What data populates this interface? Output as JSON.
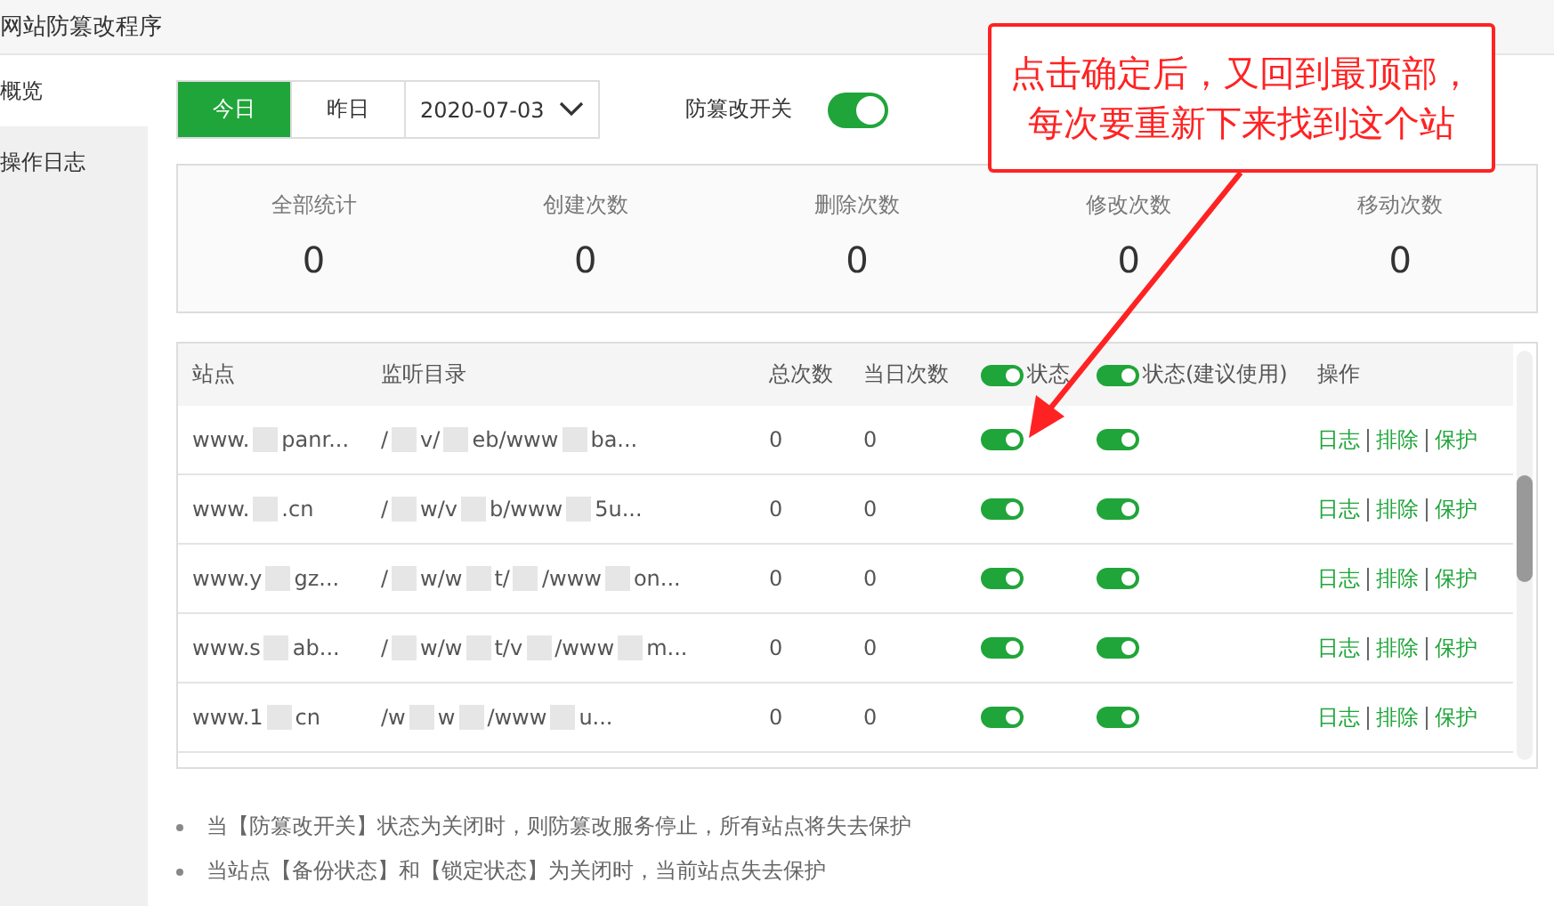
{
  "window": {
    "title": "网站防篡改程序"
  },
  "sidebar": {
    "items": [
      {
        "label": "概览",
        "selected": true
      },
      {
        "label": "操作日志",
        "selected": false
      }
    ]
  },
  "toolbar": {
    "days": [
      {
        "label": "今日",
        "selected": true
      },
      {
        "label": "昨日",
        "selected": false
      }
    ],
    "date": "2020-07-03",
    "switch": {
      "label": "防篡改开关",
      "on": true
    }
  },
  "stats": [
    {
      "label": "全部统计",
      "value": "0"
    },
    {
      "label": "创建次数",
      "value": "0"
    },
    {
      "label": "删除次数",
      "value": "0"
    },
    {
      "label": "修改次数",
      "value": "0"
    },
    {
      "label": "移动次数",
      "value": "0"
    }
  ],
  "table": {
    "columns": [
      {
        "label": "站点",
        "kind": "text"
      },
      {
        "label": "监听目录",
        "kind": "text"
      },
      {
        "label": "总次数",
        "kind": "text"
      },
      {
        "label": "当日次数",
        "kind": "text"
      },
      {
        "label": "状态",
        "kind": "toggle"
      },
      {
        "label": "状态(建议使用)",
        "kind": "toggle"
      },
      {
        "label": "操作",
        "kind": "text"
      }
    ],
    "rows": [
      {
        "site": [
          "www.",
          "panr..."
        ],
        "path": [
          "/",
          "v/",
          "eb/www",
          "ba..."
        ],
        "total": "0",
        "today": "0",
        "backup": true,
        "lock": true,
        "actions": [
          "日志",
          "排除",
          "保护"
        ]
      },
      {
        "site": [
          "www.",
          ".cn"
        ],
        "path": [
          "/",
          "w/v",
          "b/www",
          "5u..."
        ],
        "total": "0",
        "today": "0",
        "backup": true,
        "lock": true,
        "actions": [
          "日志",
          "排除",
          "保护"
        ]
      },
      {
        "site": [
          "www.y",
          "gz..."
        ],
        "path": [
          "/",
          "w/w",
          "t/",
          "/www",
          "on..."
        ],
        "total": "0",
        "today": "0",
        "backup": true,
        "lock": true,
        "actions": [
          "日志",
          "排除",
          "保护"
        ]
      },
      {
        "site": [
          "www.s",
          "ab..."
        ],
        "path": [
          "/",
          "w/w",
          "t/v",
          "/www",
          "m..."
        ],
        "total": "0",
        "today": "0",
        "backup": true,
        "lock": true,
        "actions": [
          "日志",
          "排除",
          "保护"
        ]
      },
      {
        "site": [
          "www.1",
          "cn"
        ],
        "path": [
          "/w",
          "w",
          "/www",
          "u..."
        ],
        "total": "0",
        "today": "0",
        "backup": true,
        "lock": true,
        "actions": [
          "日志",
          "排除",
          "保护"
        ]
      }
    ]
  },
  "notes": [
    "当【防篡改开关】状态为关闭时，则防篡改服务停止，所有站点将失去保护",
    "当站点【备份状态】和【锁定状态】为关闭时，当前站点失去保护"
  ],
  "annotation": {
    "lines": [
      "点击确定后，又回到最顶部，",
      "每次要重新下来找到这个站"
    ]
  }
}
